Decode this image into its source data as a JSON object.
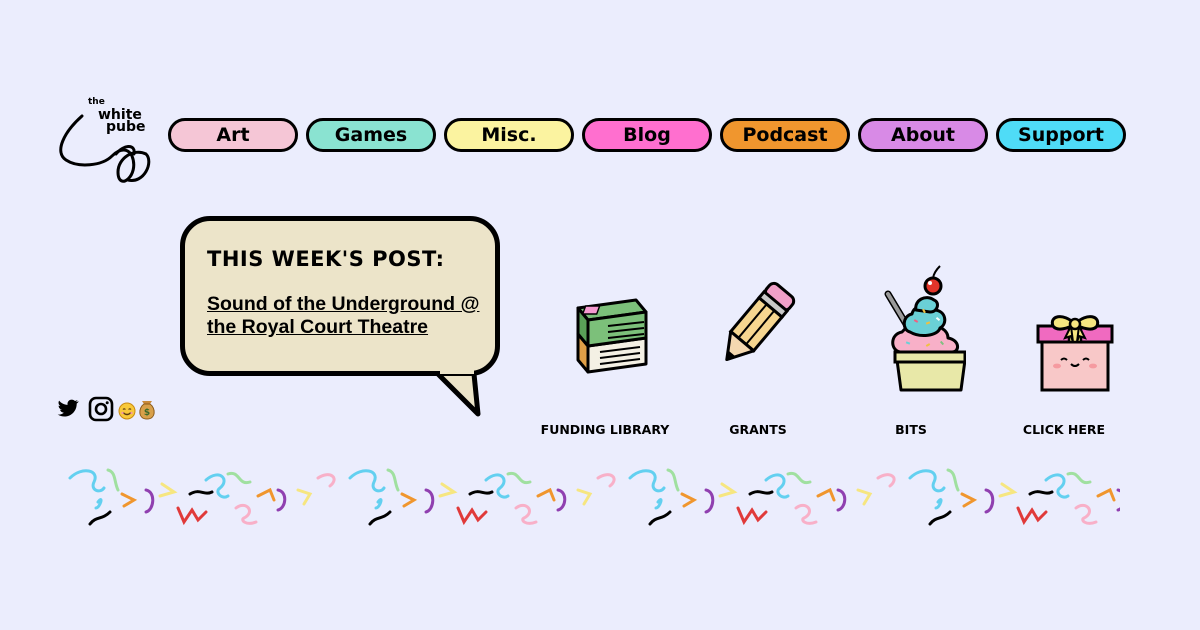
{
  "logo": {
    "line1": "the",
    "line2": "white",
    "line3": "pube"
  },
  "nav": {
    "items": [
      {
        "label": "Art",
        "color": "#f5c6d6"
      },
      {
        "label": "Games",
        "color": "#8ae3d1"
      },
      {
        "label": "Misc.",
        "color": "#fbf3a0"
      },
      {
        "label": "Blog",
        "color": "#ff6fcf"
      },
      {
        "label": "Podcast",
        "color": "#f0962e"
      },
      {
        "label": "About",
        "color": "#d88ae6"
      },
      {
        "label": "Support",
        "color": "#4fdcf7"
      }
    ]
  },
  "post": {
    "heading": "THIS WEEK'S POST:",
    "title": "Sound of the Underground @ the Royal Court Theatre"
  },
  "social": {
    "icons": [
      "twitter-icon",
      "instagram-icon",
      "smiley-icon",
      "money-bag-icon"
    ]
  },
  "features": [
    {
      "label": "FUNDING LIBRARY",
      "icon": "books-icon"
    },
    {
      "label": "GRANTS",
      "icon": "pencil-icon"
    },
    {
      "label": "BITS",
      "icon": "ice-cream-icon"
    },
    {
      "label": "CLICK HERE",
      "icon": "gift-icon"
    }
  ],
  "colors": {
    "background": "#ebedfd",
    "bubble": "#ece4c9"
  }
}
